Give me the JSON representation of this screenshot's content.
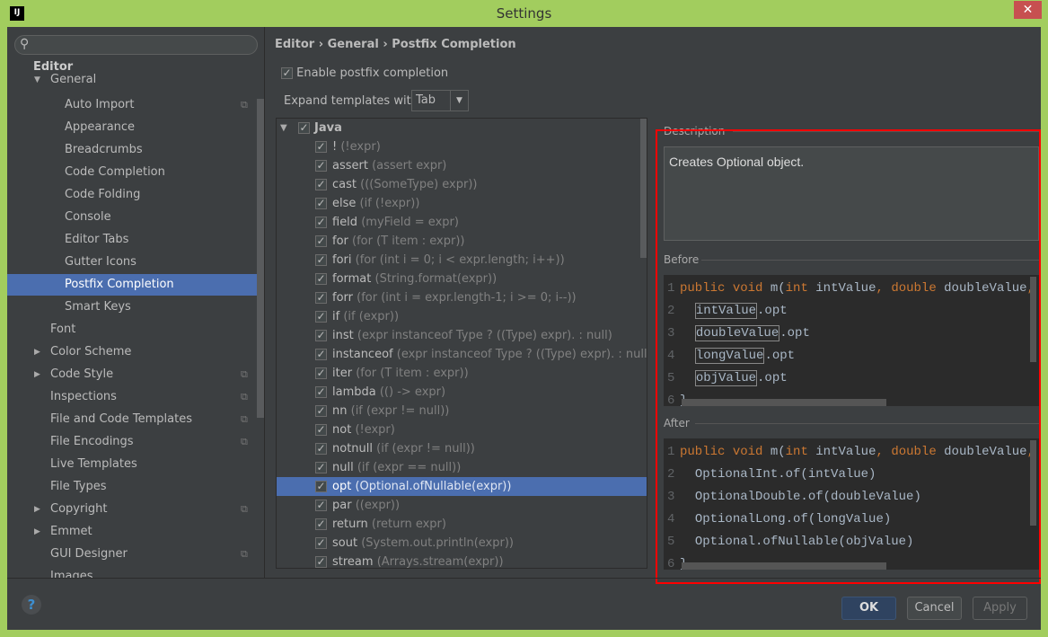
{
  "window": {
    "title": "Settings",
    "logo": "IJ"
  },
  "sidebar": {
    "search_placeholder": "",
    "items": [
      {
        "label": "Editor",
        "bold": true,
        "indent": 0
      },
      {
        "label": "General",
        "indent": 1,
        "arrow": "expanded"
      },
      {
        "label": "Auto Import",
        "indent": 2,
        "copy": true
      },
      {
        "label": "Appearance",
        "indent": 2
      },
      {
        "label": "Breadcrumbs",
        "indent": 2
      },
      {
        "label": "Code Completion",
        "indent": 2
      },
      {
        "label": "Code Folding",
        "indent": 2
      },
      {
        "label": "Console",
        "indent": 2
      },
      {
        "label": "Editor Tabs",
        "indent": 2
      },
      {
        "label": "Gutter Icons",
        "indent": 2
      },
      {
        "label": "Postfix Completion",
        "indent": 2,
        "selected": true
      },
      {
        "label": "Smart Keys",
        "indent": 2
      },
      {
        "label": "Font",
        "indent": 1
      },
      {
        "label": "Color Scheme",
        "indent": 1,
        "arrow": "collapsed"
      },
      {
        "label": "Code Style",
        "indent": 1,
        "arrow": "collapsed",
        "copy": true
      },
      {
        "label": "Inspections",
        "indent": 1,
        "copy": true
      },
      {
        "label": "File and Code Templates",
        "indent": 1,
        "copy": true
      },
      {
        "label": "File Encodings",
        "indent": 1,
        "copy": true
      },
      {
        "label": "Live Templates",
        "indent": 1
      },
      {
        "label": "File Types",
        "indent": 1
      },
      {
        "label": "Copyright",
        "indent": 1,
        "arrow": "collapsed",
        "copy": true
      },
      {
        "label": "Emmet",
        "indent": 1,
        "arrow": "collapsed"
      },
      {
        "label": "GUI Designer",
        "indent": 1,
        "copy": true
      },
      {
        "label": "Images",
        "indent": 1
      }
    ]
  },
  "breadcrumb": [
    "Editor",
    "General",
    "Postfix Completion"
  ],
  "enable_label": "Enable postfix completion",
  "enable_checked": true,
  "expand_label": "Expand templates with",
  "expand_value": "Tab",
  "tree": {
    "group": "Java",
    "items": [
      {
        "key": "!",
        "desc": "(!expr)"
      },
      {
        "key": "assert",
        "desc": "(assert expr)"
      },
      {
        "key": "cast",
        "desc": "(((SomeType) expr))"
      },
      {
        "key": "else",
        "desc": "(if (!expr))"
      },
      {
        "key": "field",
        "desc": "(myField = expr)"
      },
      {
        "key": "for",
        "desc": "(for (T item : expr))"
      },
      {
        "key": "fori",
        "desc": "(for (int i = 0; i < expr.length; i++))"
      },
      {
        "key": "format",
        "desc": "(String.format(expr))"
      },
      {
        "key": "forr",
        "desc": "(for (int i = expr.length-1; i >= 0; i--))"
      },
      {
        "key": "if",
        "desc": "(if (expr))"
      },
      {
        "key": "inst",
        "desc": "(expr instanceof Type ? ((Type) expr). : null)"
      },
      {
        "key": "instanceof",
        "desc": "(expr instanceof Type ? ((Type) expr). : null)"
      },
      {
        "key": "iter",
        "desc": "(for (T item : expr))"
      },
      {
        "key": "lambda",
        "desc": "(() -> expr)"
      },
      {
        "key": "nn",
        "desc": "(if (expr != null))"
      },
      {
        "key": "not",
        "desc": "(!expr)"
      },
      {
        "key": "notnull",
        "desc": "(if (expr != null))"
      },
      {
        "key": "null",
        "desc": "(if (expr == null))"
      },
      {
        "key": "opt",
        "desc": "(Optional.ofNullable(expr))",
        "selected": true
      },
      {
        "key": "par",
        "desc": "((expr))"
      },
      {
        "key": "return",
        "desc": "(return expr)"
      },
      {
        "key": "sout",
        "desc": "(System.out.println(expr))"
      },
      {
        "key": "stream",
        "desc": "(Arrays.stream(expr))"
      }
    ]
  },
  "description": {
    "label": "Description",
    "text": "Creates Optional object."
  },
  "before": {
    "label": "Before",
    "signature_kw": [
      "public",
      "void"
    ],
    "signature": "m(",
    "params": "int intValue, double doubleValue, lo",
    "lines": [
      {
        "n": "2",
        "boxed": "intValue",
        "rest": ".opt"
      },
      {
        "n": "3",
        "boxed": "doubleValue",
        "rest": ".opt"
      },
      {
        "n": "4",
        "boxed": "longValue",
        "rest": ".opt"
      },
      {
        "n": "5",
        "boxed": "objValue",
        "rest": ".opt"
      }
    ],
    "last": "6",
    "last_text": "}"
  },
  "after": {
    "label": "After",
    "lines": [
      {
        "n": "2",
        "text": "OptionalInt.of(intValue)"
      },
      {
        "n": "3",
        "text": "OptionalDouble.of(doubleValue)"
      },
      {
        "n": "4",
        "text": "OptionalLong.of(longValue)"
      },
      {
        "n": "5",
        "text": "Optional.ofNullable(objValue)"
      }
    ],
    "last": "6",
    "last_text": "}"
  },
  "footer": {
    "help": "?",
    "ok": "OK",
    "cancel": "Cancel",
    "apply": "Apply"
  },
  "colors": {
    "accent": "#4b6eaf",
    "highlight_frame": "#ff0000",
    "keyword": "#cc7832",
    "window_frame": "#a2cd5e"
  }
}
